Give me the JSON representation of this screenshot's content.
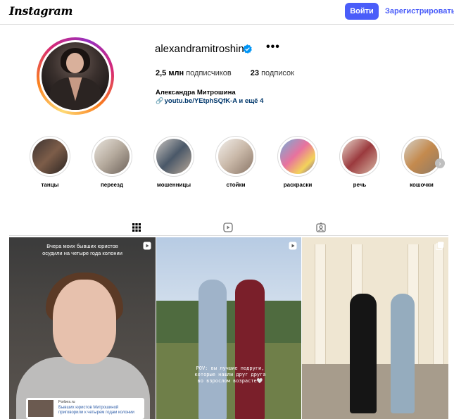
{
  "topbar": {
    "logo": "Instagram",
    "login_label": "Войти",
    "signup_label": "Зарегистрироваться"
  },
  "profile": {
    "username": "alexandramitroshina",
    "more": "•••",
    "followers_count": "2,5 млн",
    "followers_label": "подписчиков",
    "following_count": "23",
    "following_label": "подписок",
    "full_name": "Александра Митрошина",
    "link": "youtu.be/YEtphSQfK-A и ещё 4"
  },
  "highlights": [
    {
      "label": "танцы",
      "icon": "highlight-dance"
    },
    {
      "label": "переезд",
      "icon": "highlight-move"
    },
    {
      "label": "мошенницы",
      "icon": "highlight-scammers"
    },
    {
      "label": "стойки",
      "icon": "highlight-handstands"
    },
    {
      "label": "раскраски",
      "icon": "highlight-coloring"
    },
    {
      "label": "речь",
      "icon": "highlight-speech"
    },
    {
      "label": "кошочки",
      "icon": "highlight-cats"
    }
  ],
  "tabs": [
    {
      "name": "posts",
      "icon": "grid-icon",
      "active": true
    },
    {
      "name": "reels",
      "icon": "reels-icon",
      "active": false
    },
    {
      "name": "tagged",
      "icon": "tagged-icon",
      "active": false
    }
  ],
  "posts": [
    {
      "type": "reel",
      "caption": "Вчера моих бывших юристов осудили на четыре года колонии",
      "news_source": "Forbes.ru",
      "news_title": "Бывших юристов Митрошиной приговорили к четырем годам колонии"
    },
    {
      "type": "reel",
      "caption": "POV: вы лучшие подруги, которые нашли друг друга во взрослом возрасте🤍"
    },
    {
      "type": "carousel"
    }
  ],
  "colors": {
    "accent": "#4a5df9",
    "link": "#00376b",
    "verified": "#0095f6",
    "border": "#dbdbdb"
  }
}
